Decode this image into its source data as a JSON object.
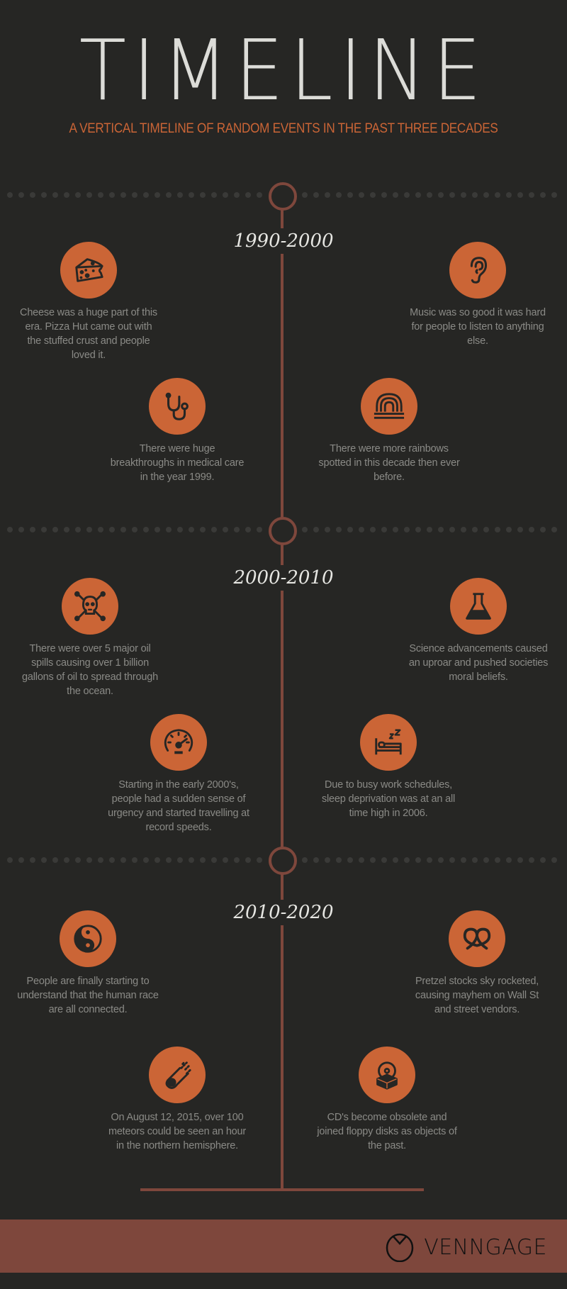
{
  "header": {
    "title": "TIMELINE",
    "subtitle": "A VERTICAL TIMELINE OF RANDOM EVENTS IN THE PAST THREE DECADES"
  },
  "colors": {
    "background": "#262624",
    "accent": "#CB6536",
    "line": "#7E473C",
    "title_text": "#DCDCD8",
    "body_text": "#8A8A86"
  },
  "sections": [
    {
      "period": "1990-2000",
      "events": [
        {
          "icon": "cheese-icon",
          "text": "Cheese was a huge part of this era.  Pizza Hut came out with the stuffed crust and people loved it."
        },
        {
          "icon": "ear-icon",
          "text": "Music was so good it was hard for people to listen to anything else."
        },
        {
          "icon": "stethoscope-icon",
          "text": "There were huge breakthroughs in medical care in the year 1999."
        },
        {
          "icon": "rainbow-icon",
          "text": "There were more rainbows spotted in this decade then ever before."
        }
      ]
    },
    {
      "period": "2000-2010",
      "events": [
        {
          "icon": "skull-crossbones-icon",
          "text": "There were over 5 major oil spills causing over 1 billion gallons of oil to spread through the ocean."
        },
        {
          "icon": "flask-icon",
          "text": "Science advancements caused an uproar and pushed societies moral beliefs."
        },
        {
          "icon": "speedometer-icon",
          "text": "Starting in the early 2000's, people had a sudden sense of urgency and started travelling at record speeds."
        },
        {
          "icon": "bed-sleep-icon",
          "text": "Due to busy work schedules, sleep deprivation was at an all time high in 2006."
        }
      ]
    },
    {
      "period": "2010-2020",
      "events": [
        {
          "icon": "yin-yang-icon",
          "text": "People are finally starting to understand that the human race are all connected."
        },
        {
          "icon": "pretzel-icon",
          "text": "Pretzel stocks sky rocketed, causing mayhem on Wall St and street vendors."
        },
        {
          "icon": "meteor-icon",
          "text": "On August 12, 2015, over 100 meteors could be seen an hour in the northern hemisphere."
        },
        {
          "icon": "cd-box-icon",
          "text": "CD's become obsolete and joined floppy disks as objects of the past."
        }
      ]
    }
  ],
  "footer": {
    "brand": "VENNGAGE",
    "logo_icon": "venngage-logo-icon"
  }
}
